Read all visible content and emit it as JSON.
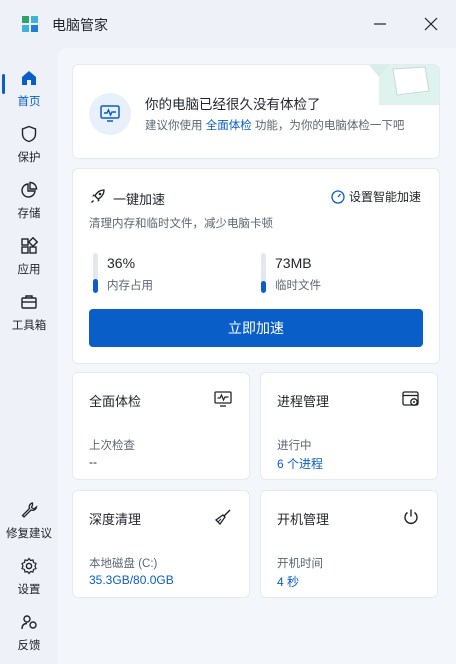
{
  "window": {
    "title": "电脑管家"
  },
  "sidebar": {
    "items": [
      {
        "label": "首页",
        "icon": "home-icon",
        "active": true
      },
      {
        "label": "保护",
        "icon": "shield-icon"
      },
      {
        "label": "存储",
        "icon": "pie-chart-icon"
      },
      {
        "label": "应用",
        "icon": "apps-icon"
      },
      {
        "label": "工具箱",
        "icon": "toolbox-icon"
      },
      {
        "label": "修复建议",
        "icon": "wrench-icon"
      },
      {
        "label": "设置",
        "icon": "gear-icon"
      },
      {
        "label": "反馈",
        "icon": "feedback-icon"
      }
    ]
  },
  "banner": {
    "title": "你的电脑已经很久没有体检了",
    "sub_prefix": "建议你使用",
    "sub_link": "全面体检",
    "sub_suffix": "功能，为你的电脑体检一下吧"
  },
  "speedup": {
    "title": "一键加速",
    "settings_label": "设置智能加速",
    "description": "清理内存和临时文件，减少电脑卡顿",
    "memory": {
      "value": "36%",
      "label": "内存占用",
      "level": 0.36
    },
    "temp": {
      "value": "73MB",
      "label": "临时文件",
      "level": 0.3
    },
    "button_label": "立即加速"
  },
  "tiles": {
    "checkup": {
      "title": "全面体检",
      "label": "上次检查",
      "value": "--",
      "icon": "monitor-pulse-icon"
    },
    "process": {
      "title": "进程管理",
      "label": "进行中",
      "value": "6 个进程",
      "icon": "window-gear-icon"
    },
    "cleanup": {
      "title": "深度清理",
      "label": "本地磁盘 (C:)",
      "value": "35.3GB/80.0GB",
      "icon": "broom-icon"
    },
    "boot": {
      "title": "开机管理",
      "label": "开机时间",
      "value": "4 秒",
      "icon": "power-icon"
    }
  },
  "colors": {
    "accent": "#0a5ec8",
    "background": "#eef2f8"
  }
}
